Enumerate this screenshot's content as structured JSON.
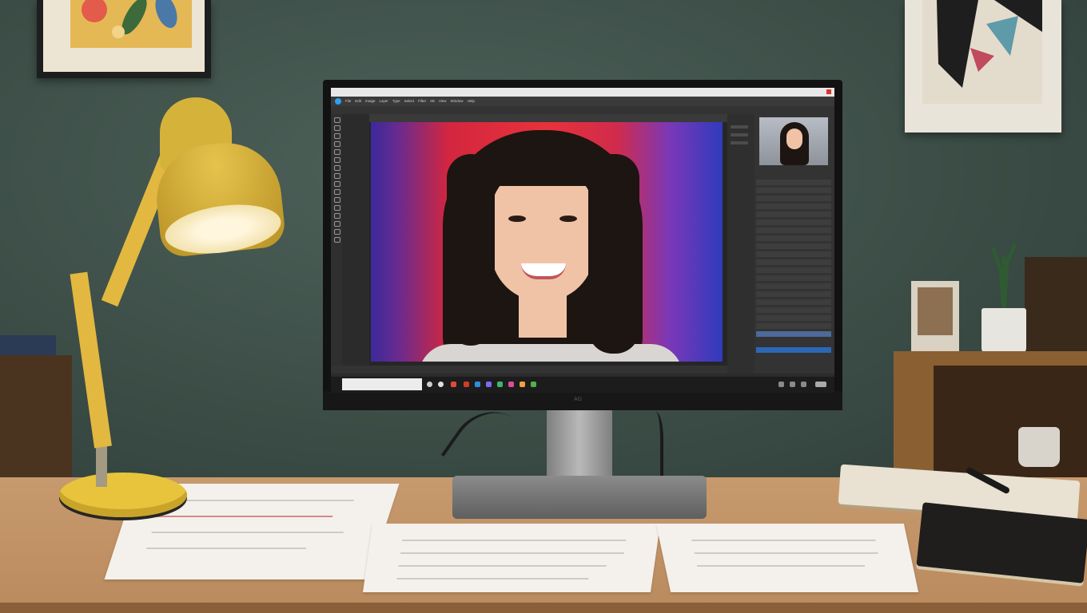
{
  "scene": {
    "description_free": true
  },
  "photoshop": {
    "title_text": "Ps",
    "menu_items": [
      "File",
      "Edit",
      "Image",
      "Layer",
      "Type",
      "Select",
      "Filter",
      "3D",
      "View",
      "Window",
      "Help"
    ],
    "zoom_text": "",
    "search_placeholder": "",
    "monitor_brand": "AG"
  },
  "colors": {
    "canvas_left": "#3a2a9c",
    "canvas_center": "#e8323a",
    "canvas_right": "#2f3bbd",
    "lamp": "#e2b840",
    "desk": "#c79a6e",
    "wall": "#3f514a"
  },
  "icons": {
    "tools": [
      "move-icon",
      "marquee-icon",
      "lasso-icon",
      "crop-icon",
      "eyedropper-icon",
      "brush-icon",
      "stamp-icon",
      "eraser-icon",
      "gradient-icon",
      "dodge-icon",
      "pen-icon",
      "type-icon",
      "path-icon",
      "shape-icon",
      "hand-icon",
      "zoom-icon"
    ]
  }
}
